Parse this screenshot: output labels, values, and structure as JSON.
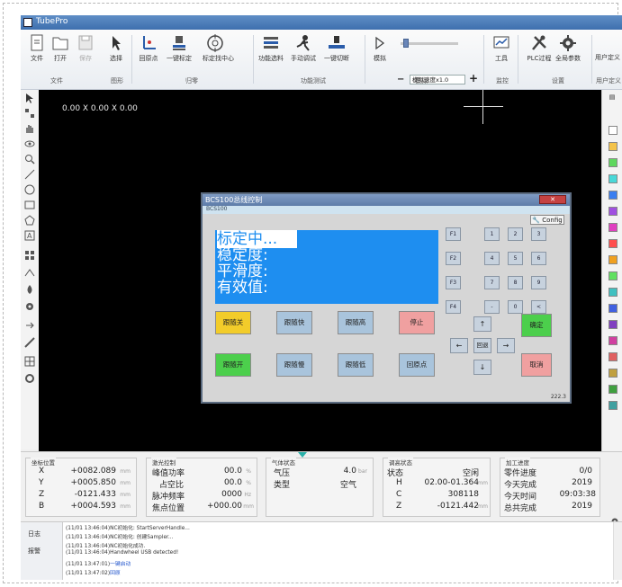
{
  "window": {
    "title": "TubePro"
  },
  "ribbon": {
    "buttons": [
      {
        "label": "文件"
      },
      {
        "label": "打开"
      },
      {
        "label": "保存"
      },
      {
        "label": "选择"
      },
      {
        "label": "回原点"
      },
      {
        "label": "一键标定"
      },
      {
        "label": "标定找中心"
      },
      {
        "label": "功能选料"
      },
      {
        "label": "手动调试"
      },
      {
        "label": "一键切断"
      },
      {
        "label": "模拟"
      },
      {
        "label": "工具"
      },
      {
        "label": "PLC过程"
      },
      {
        "label": "全局参数"
      },
      {
        "label": "用户定义"
      }
    ],
    "groups": [
      {
        "label": "文件"
      },
      {
        "label": "图形"
      },
      {
        "label": "归零"
      },
      {
        "label": "功能测试"
      },
      {
        "label": "模拟"
      },
      {
        "label": "监控"
      },
      {
        "label": "设置"
      },
      {
        "label": "用户定义"
      }
    ],
    "speed_select": {
      "value": "模拟速度x1.0"
    },
    "speed_slider": {
      "level": 0.05
    }
  },
  "canvas": {
    "coord_text": "0.00 X 0.00 X 0.00"
  },
  "dialog": {
    "title": "BCS100总线控制",
    "subtitle": "BCS100",
    "config_label": "Config",
    "status_lines": [
      "标定中...",
      "稳定度:",
      "平滑度:",
      "有效值:"
    ],
    "buttons": [
      {
        "label": "跟随关",
        "color": "#f2cc2a"
      },
      {
        "label": "跟随快",
        "color": "#a9c4dc"
      },
      {
        "label": "跟随高",
        "color": "#a9c4dc"
      },
      {
        "label": "停止",
        "color": "#f0a0a0"
      },
      {
        "label": "跟随开",
        "color": "#4ccf4c"
      },
      {
        "label": "跟随慢",
        "color": "#a9c4dc"
      },
      {
        "label": "跟随低",
        "color": "#a9c4dc"
      },
      {
        "label": "回原点",
        "color": "#a9c4dc"
      }
    ],
    "fkeys": [
      "F1",
      "F2",
      "F3",
      "F4"
    ],
    "numpad": [
      "1",
      "2",
      "3",
      "4",
      "5",
      "6",
      "7",
      "8",
      "9",
      "-",
      "0",
      "<"
    ],
    "arrows": {
      "up": "↑",
      "left": "←",
      "center": "回退",
      "right": "→",
      "down": "↓"
    },
    "confirm_label": "确定",
    "cancel_label": "取消",
    "footer": "222.3"
  },
  "panels": {
    "position": {
      "title": "坐标位置",
      "rows": [
        {
          "axis": "X",
          "value": "+0082.089",
          "unit": "mm"
        },
        {
          "axis": "Y",
          "value": "+0005.850",
          "unit": "mm"
        },
        {
          "axis": "Z",
          "value": "-0121.433",
          "unit": "mm"
        },
        {
          "axis": "B",
          "value": "+0004.593",
          "unit": "mm"
        }
      ]
    },
    "laser": {
      "title": "激光控制",
      "rows": [
        {
          "key": "峰值功率",
          "value": "00.0",
          "unit": "%"
        },
        {
          "key": "占空比",
          "value": "00.0",
          "unit": "%"
        },
        {
          "key": "脉冲频率",
          "value": "0000",
          "unit": "Hz"
        },
        {
          "key": "焦点位置",
          "value": "+000.00",
          "unit": "mm"
        }
      ]
    },
    "gas": {
      "title": "气体状态",
      "rows": [
        {
          "key": "气压",
          "value": "4.0",
          "unit": "bar"
        },
        {
          "key": "类型",
          "value": "空气",
          "unit": ""
        }
      ]
    },
    "follow": {
      "title": "调高状态",
      "rows": [
        {
          "key": "状态",
          "value": "空闲",
          "unit": ""
        },
        {
          "key": "H",
          "value": "02.00-01.364",
          "unit": "mm"
        },
        {
          "key": "C",
          "value": "308118",
          "unit": ""
        },
        {
          "key": "Z",
          "value": "-0121.442",
          "unit": "mm"
        }
      ]
    },
    "progress": {
      "title": "加工进度",
      "rows": [
        {
          "key": "零件进度",
          "value": "0/0"
        },
        {
          "key": "今天完成",
          "value": "2019"
        },
        {
          "key": "今天时间",
          "value": "09:03:38"
        },
        {
          "key": "总共完成",
          "value": "2019"
        }
      ]
    }
  },
  "log": {
    "tabs": [
      "日志",
      "报警"
    ],
    "lines": [
      {
        "text": "(11/01 13:46:04)NC初始化: StartServerHandle...",
        "hl": ""
      },
      {
        "text": "(11/01 13:46:04)NC初始化: 创建Sampler...",
        "hl": ""
      },
      {
        "text": "(11/01 13:46:04)NC初始化成功.",
        "hl": ""
      },
      {
        "text": "(11/01 13:46:04)Handwheel USB detected!",
        "hl": ""
      },
      {
        "text": "(11/01 13:47:01)",
        "hl": "一键启动"
      },
      {
        "text": "(11/01 13:47:02)",
        "hl": "回原"
      }
    ]
  },
  "colors": {
    "accent": "#1e8ef0",
    "swatches": [
      "#ffffff",
      "#f3c34a",
      "#5fd85f",
      "#48d8d8",
      "#3a7ef0",
      "#a050e0",
      "#e040c0",
      "#ff4f4f",
      "#f0a020",
      "#60e060",
      "#40c0c0",
      "#4060e0",
      "#8040c0",
      "#d040a0",
      "#e06060",
      "#c0a040",
      "#40a040",
      "#40a0a0"
    ]
  }
}
